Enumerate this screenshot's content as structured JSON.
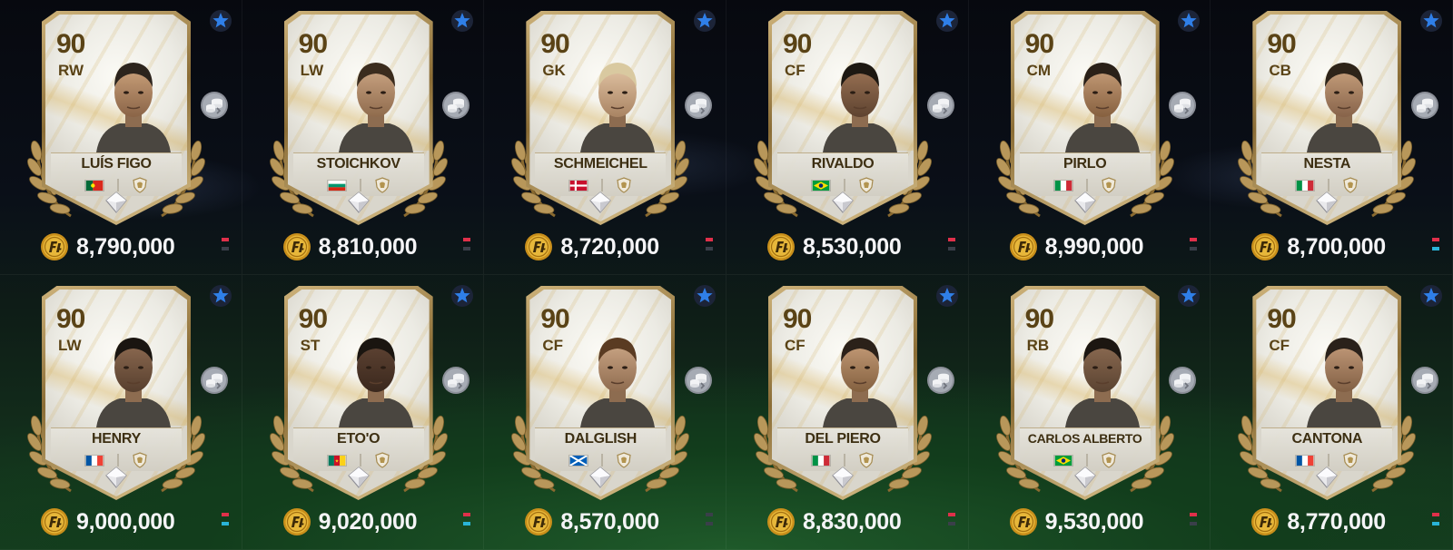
{
  "cards": [
    {
      "rating": "90",
      "position": "RW",
      "name": "LUÍS FIGO",
      "nation": "portugal-flag",
      "price": "8,790,000",
      "trend": [
        "#e0304a",
        "#3a3f4a"
      ]
    },
    {
      "rating": "90",
      "position": "LW",
      "name": "STOICHKOV",
      "nation": "bulgaria-flag",
      "price": "8,810,000",
      "trend": [
        "#e0304a",
        "#3a3f4a"
      ]
    },
    {
      "rating": "90",
      "position": "GK",
      "name": "SCHMEICHEL",
      "nation": "denmark-flag",
      "price": "8,720,000",
      "trend": [
        "#e0304a",
        "#3a3f4a"
      ]
    },
    {
      "rating": "90",
      "position": "CF",
      "name": "RIVALDO",
      "nation": "brazil-flag",
      "price": "8,530,000",
      "trend": [
        "#e0304a",
        "#3a3f4a"
      ]
    },
    {
      "rating": "90",
      "position": "CM",
      "name": "PIRLO",
      "nation": "italy-flag",
      "price": "8,990,000",
      "trend": [
        "#e0304a",
        "#3a3f4a"
      ]
    },
    {
      "rating": "90",
      "position": "CB",
      "name": "NESTA",
      "nation": "italy-flag",
      "price": "8,700,000",
      "trend": [
        "#e0304a",
        "#2ab4d8"
      ]
    },
    {
      "rating": "90",
      "position": "LW",
      "name": "HENRY",
      "nation": "france-flag",
      "price": "9,000,000",
      "trend": [
        "#e0304a",
        "#2ab4d8"
      ]
    },
    {
      "rating": "90",
      "position": "ST",
      "name": "ETO'O",
      "nation": "cameroon-flag",
      "price": "9,020,000",
      "trend": [
        "#e0304a",
        "#2ab4d8"
      ]
    },
    {
      "rating": "90",
      "position": "CF",
      "name": "DALGLISH",
      "nation": "scotland-flag",
      "price": "8,570,000",
      "trend": [
        "#3a3f4a",
        "#3a3f4a"
      ]
    },
    {
      "rating": "90",
      "position": "CF",
      "name": "DEL PIERO",
      "nation": "italy-flag",
      "price": "8,830,000",
      "trend": [
        "#e0304a",
        "#3a3f4a"
      ]
    },
    {
      "rating": "90",
      "position": "RB",
      "name": "CARLOS ALBERTO",
      "nation": "brazil-flag",
      "price": "9,530,000",
      "trend": [
        "#e0304a",
        "#3a3f4a"
      ]
    },
    {
      "rating": "90",
      "position": "CF",
      "name": "CANTONA",
      "nation": "france-flag",
      "price": "8,770,000",
      "trend": [
        "#e0304a",
        "#2ab4d8"
      ]
    }
  ],
  "icons": {
    "favorite": "star-icon",
    "quick_sell": "coins-stack-icon",
    "currency": "fc-coin-icon",
    "chemistry": "diamond-icon",
    "club_badge": "icon-shield-icon"
  },
  "colors": {
    "card_text": "#5a4316",
    "price_text": "#f4f4f6",
    "star_blue": "#2f7fe8",
    "coin_gold": "#e7b73a"
  }
}
